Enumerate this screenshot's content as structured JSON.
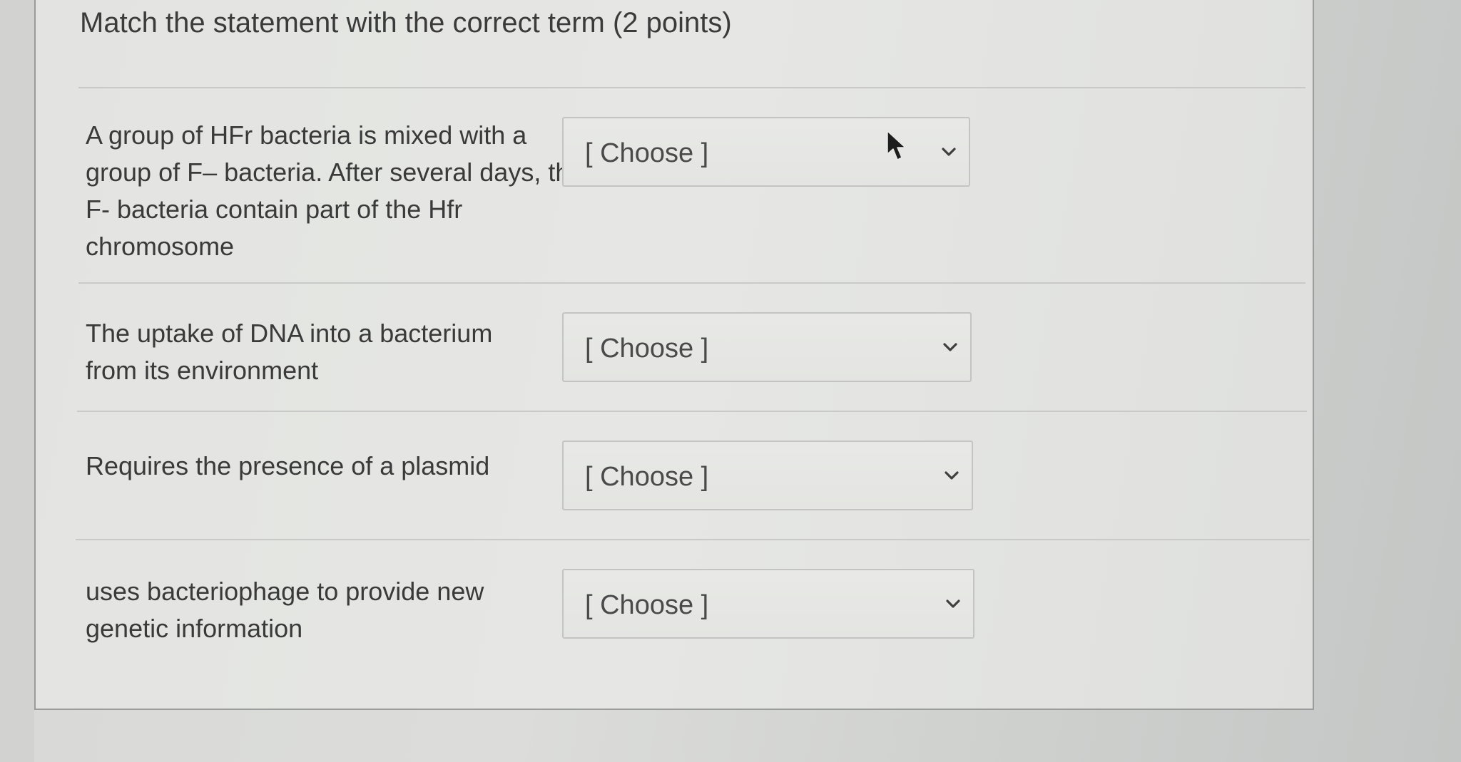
{
  "quiz": {
    "title": "Match the statement with the correct term (2 points)",
    "select_placeholder": "[ Choose ]",
    "items": [
      {
        "statement": "A group of HFr bacteria is mixed with a group of F– bacteria. After several days, the F- bacteria contain part of the Hfr chromosome",
        "selected": "[ Choose ]"
      },
      {
        "statement": "The uptake of DNA into a bacterium from its environment",
        "selected": "[ Choose ]"
      },
      {
        "statement": "Requires the presence of a plasmid",
        "selected": "[ Choose ]"
      },
      {
        "statement": "uses bacteriophage to provide new genetic information",
        "selected": "[ Choose ]"
      }
    ]
  },
  "icons": {
    "dropdown": "chevron-down-icon",
    "cursor": "mouse-pointer-icon"
  },
  "colors": {
    "text": "#3b3b3c",
    "border": "#c4c5c3",
    "background": "#e4e5e2"
  }
}
